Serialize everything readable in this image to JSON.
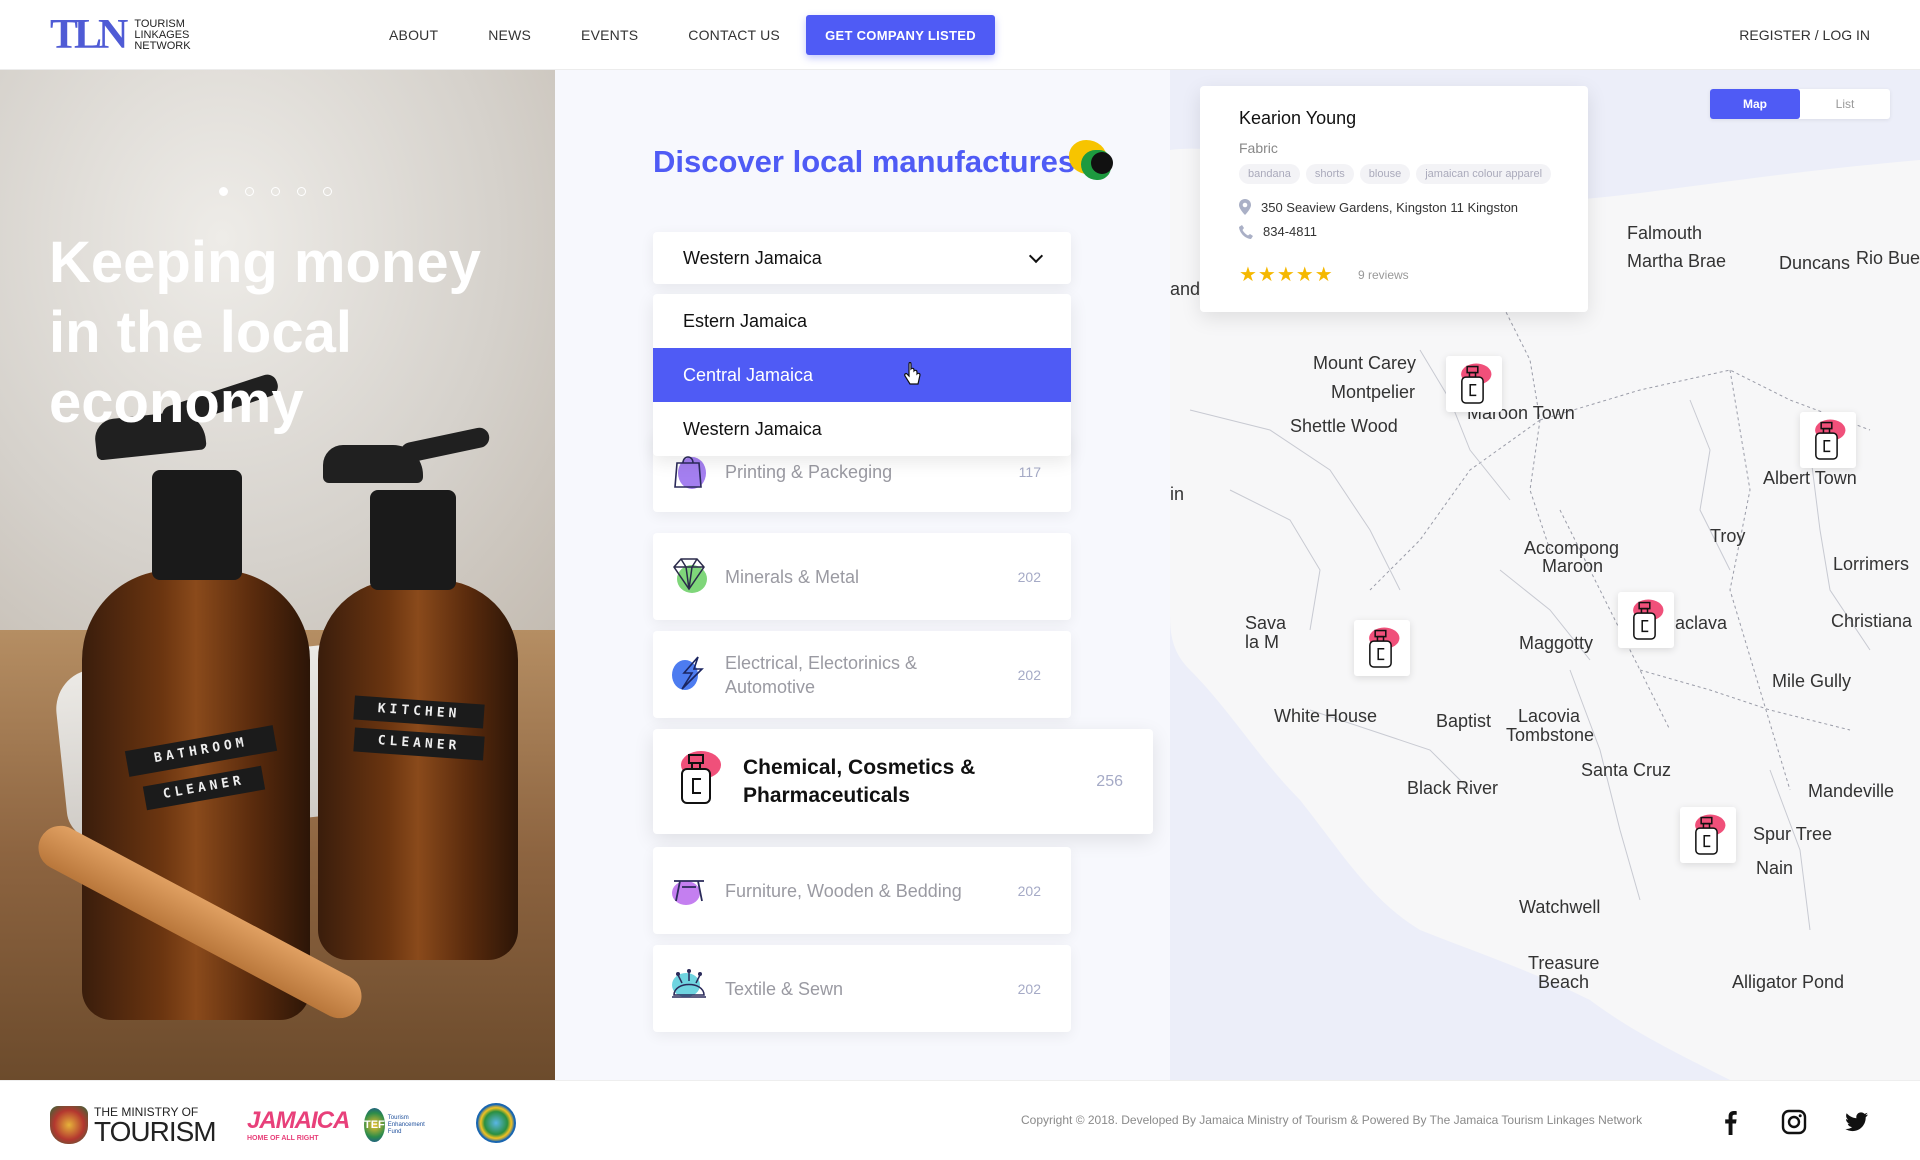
{
  "header": {
    "logo_letters": "TLN",
    "logo_line1": "Tourism",
    "logo_line2": "Linkages",
    "logo_line3": "Network",
    "nav": [
      "ABOUT",
      "NEWS",
      "EVENTS",
      "CONTACT US"
    ],
    "cta": "GET COMPANY LISTED",
    "login": "REGISTER / LOG IN"
  },
  "hero": {
    "title": "Keeping money in the local economy",
    "slides": 5,
    "active_slide": 1,
    "label_left_1": "BATHROOM",
    "label_left_2": "CLEANER",
    "label_right_1": "KITCHEN",
    "label_right_2": "CLEANER"
  },
  "discover": {
    "heading": "Discover local manufactures",
    "region_selected": "Western Jamaica",
    "region_options": [
      "Estern Jamaica",
      "Central Jamaica",
      "Western Jamaica"
    ],
    "region_highlighted": "Central Jamaica"
  },
  "categories": [
    {
      "name": "Printing & Packeging",
      "count": "117",
      "icon": "shopping-bag-icon"
    },
    {
      "name": "Minerals & Metal",
      "count": "202",
      "icon": "diamond-icon"
    },
    {
      "name": "Electrical, Electorinics & Automotive",
      "count": "202",
      "icon": "lightning-icon"
    },
    {
      "name": "Chemical, Cosmetics & Pharmaceuticals",
      "count": "256",
      "icon": "perfume-bottle-icon"
    },
    {
      "name": "Furniture, Wooden & Bedding",
      "count": "202",
      "icon": "table-icon"
    },
    {
      "name": "Textile & Sewn",
      "count": "202",
      "icon": "pincushion-icon"
    }
  ],
  "map": {
    "view_map": "Map",
    "view_list": "List",
    "places": [
      "Falmouth",
      "Martha Brae",
      "Duncans",
      "Rio Bue",
      "and",
      "Mount Carey",
      "Montpelier",
      "Shettle Wood",
      "Maroon Town",
      "Albert Town",
      "in",
      "Troy",
      "Accompong",
      "Maroon",
      "Lorrimers",
      "Sava",
      "la M",
      "aclava",
      "Christiana",
      "Maggotty",
      "Mile Gully",
      "White House",
      "Baptist",
      "Lacovia",
      "Tombstone",
      "Santa Cruz",
      "Black River",
      "Mandeville",
      "Spur Tree",
      "Nain",
      "Watchwell",
      "Treasure",
      "Beach",
      "Alligator Pond"
    ]
  },
  "listing": {
    "name": "Kearion Young",
    "category": "Fabric",
    "tags": [
      "bandana",
      "shorts",
      "blouse",
      "jamaican colour apparel"
    ],
    "address": "350 Seaview Gardens, Kingston 11 Kingston",
    "phone": "834-4811",
    "stars": "★★★★★",
    "rating": 5,
    "reviews": "9 reviews"
  },
  "footer": {
    "ministry_line1": "THE MINISTRY OF",
    "ministry_line2": "TOURISM",
    "jamaica_logo": "JAMAICA",
    "jamaica_tagline": "HOME OF ALL RIGHT",
    "tef": "TEF",
    "tef_sub": "Tourism Enhancement Fund",
    "copyright": "Copyright © 2018. Developed By Jamaica Ministry of Tourism & Powered By The Jamaica Tourism Linkages Network",
    "social": [
      "facebook-icon",
      "instagram-icon",
      "twitter-icon"
    ]
  },
  "colors": {
    "accent": "#4f5bf5",
    "map_bg": "#eceef9",
    "pin_pink": "#f0507a",
    "star": "#f5b800"
  }
}
